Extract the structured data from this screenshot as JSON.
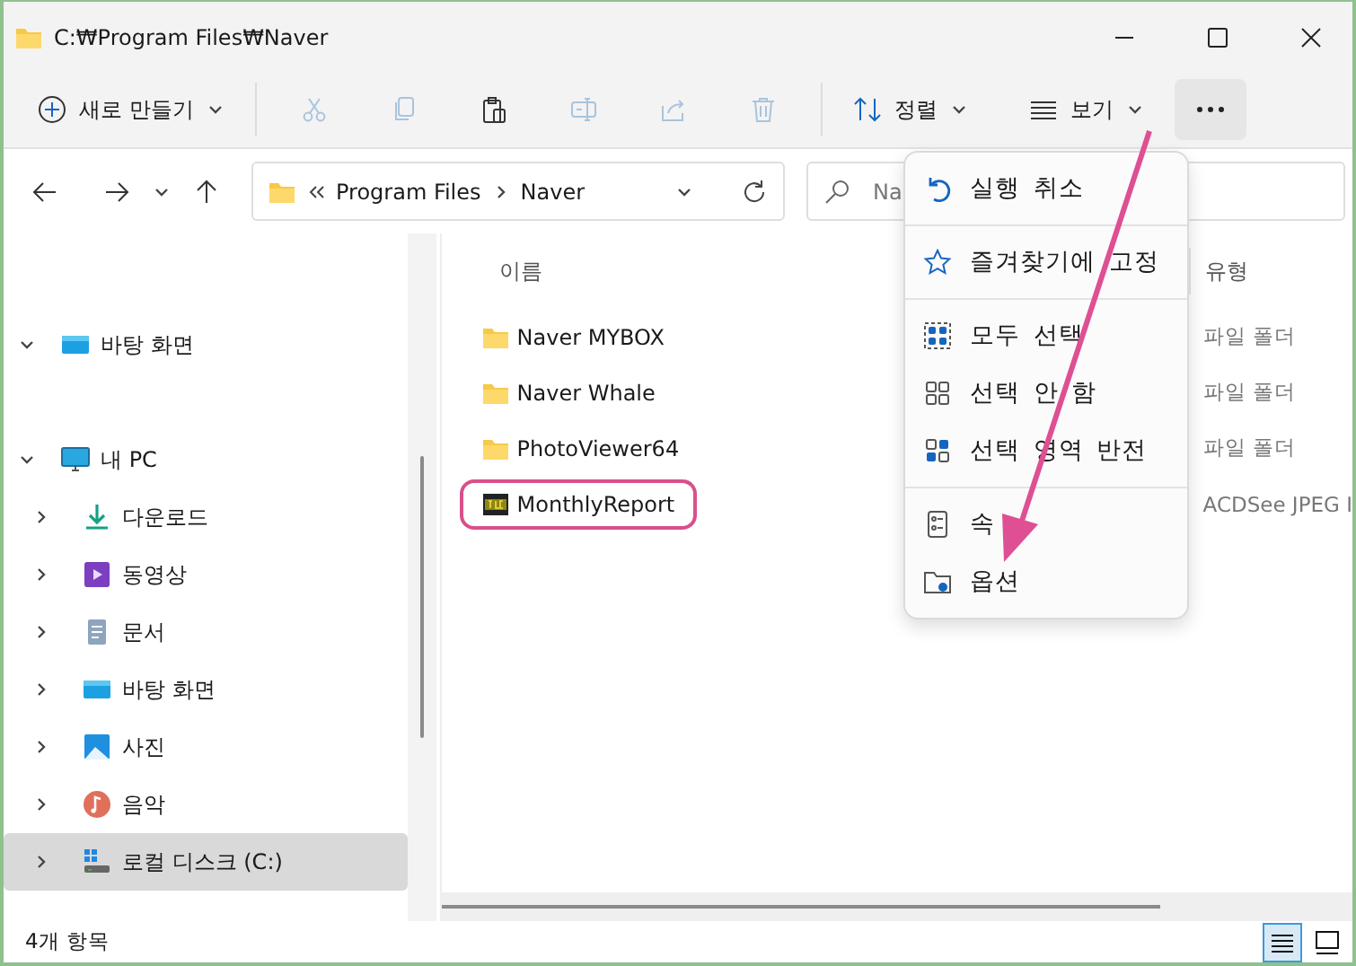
{
  "window": {
    "title": "C:₩Program Files₩Naver"
  },
  "toolbar": {
    "new_label": "새로 만들기",
    "actions": [
      {
        "kind": "cut",
        "disabled": true
      },
      {
        "kind": "copy",
        "disabled": true
      },
      {
        "kind": "paste",
        "disabled": false
      },
      {
        "kind": "rename",
        "disabled": true
      },
      {
        "kind": "share",
        "disabled": true
      },
      {
        "kind": "delete",
        "disabled": true
      }
    ],
    "sort_label": "정렬",
    "view_label": "보기",
    "more_pressed": true
  },
  "address": {
    "crumbs": [
      "Program Files",
      "Naver"
    ],
    "search_placeholder": "Na"
  },
  "sidebar": {
    "items": [
      {
        "label": "바탕 화면",
        "kind": "desktop",
        "expanded": true,
        "selected": false
      },
      {
        "label": "내 PC",
        "kind": "pc",
        "expanded": true,
        "selected": false,
        "children": [
          {
            "label": "다운로드",
            "kind": "download",
            "expanded": false,
            "selected": false
          },
          {
            "label": "동영상",
            "kind": "video",
            "expanded": false,
            "selected": false
          },
          {
            "label": "문서",
            "kind": "docs",
            "expanded": false,
            "selected": false
          },
          {
            "label": "바탕 화면",
            "kind": "desktop",
            "expanded": false,
            "selected": false
          },
          {
            "label": "사진",
            "kind": "pictures",
            "expanded": false,
            "selected": false
          },
          {
            "label": "음악",
            "kind": "music",
            "expanded": false,
            "selected": false
          },
          {
            "label": "로컬 디스크 (C:)",
            "kind": "drive",
            "expanded": false,
            "selected": true
          }
        ]
      }
    ]
  },
  "files": {
    "columns": [
      "이름",
      "유형"
    ],
    "rows": [
      {
        "name": "Naver MYBOX",
        "type": "파일 폴더",
        "kind": "folder",
        "highlighted": false
      },
      {
        "name": "Naver Whale",
        "type": "파일 폴더",
        "kind": "folder",
        "highlighted": false
      },
      {
        "name": "PhotoViewer64",
        "type": "파일 폴더",
        "kind": "folder",
        "highlighted": false
      },
      {
        "name": "MonthlyReport",
        "type": "ACDSee JPEG I",
        "kind": "jpg",
        "highlighted": true
      }
    ]
  },
  "menu": {
    "groups": [
      [
        {
          "kind": "undo",
          "label": "실행 취소"
        }
      ],
      [
        {
          "kind": "pin",
          "label": "즐겨찾기에 고정"
        }
      ],
      [
        {
          "kind": "select_all",
          "label": "모두 선택"
        },
        {
          "kind": "select_none",
          "label": "선택 안 함"
        },
        {
          "kind": "invert",
          "label": "선택 영역 반전"
        }
      ],
      [
        {
          "kind": "properties",
          "label": "속"
        },
        {
          "kind": "options",
          "label": "옵션"
        }
      ]
    ]
  },
  "status": {
    "count": "4개 항목",
    "view_modes": [
      {
        "kind": "details",
        "selected": true
      },
      {
        "kind": "tiles",
        "selected": false
      }
    ]
  }
}
